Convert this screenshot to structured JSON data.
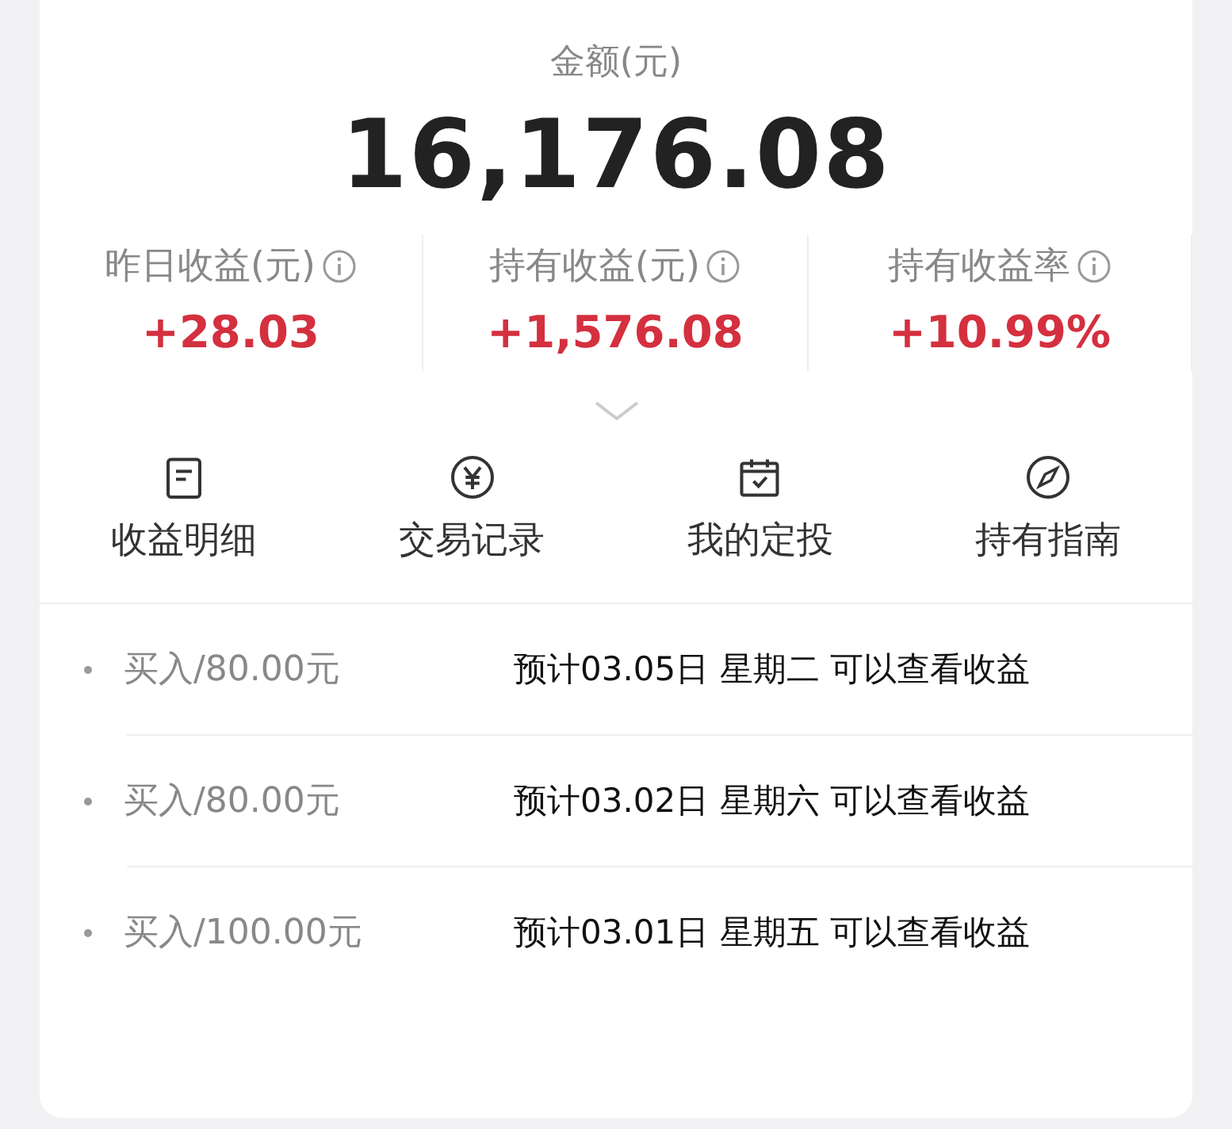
{
  "summary": {
    "label": "金额(元)",
    "amount": "16,176.08"
  },
  "stats": [
    {
      "label": "昨日收益(元)",
      "value": "+28.03"
    },
    {
      "label": "持有收益(元)",
      "value": "+1,576.08"
    },
    {
      "label": "持有收益率",
      "value": "+10.99%"
    }
  ],
  "actions": [
    {
      "label": "收益明细"
    },
    {
      "label": "交易记录"
    },
    {
      "label": "我的定投"
    },
    {
      "label": "持有指南"
    }
  ],
  "records": [
    {
      "amount": "买入/80.00元",
      "note": "预计03.05日 星期二 可以查看收益"
    },
    {
      "amount": "买入/80.00元",
      "note": "预计03.02日 星期六 可以查看收益"
    },
    {
      "amount": "买入/100.00元",
      "note": "预计03.01日 星期五 可以查看收益"
    }
  ]
}
